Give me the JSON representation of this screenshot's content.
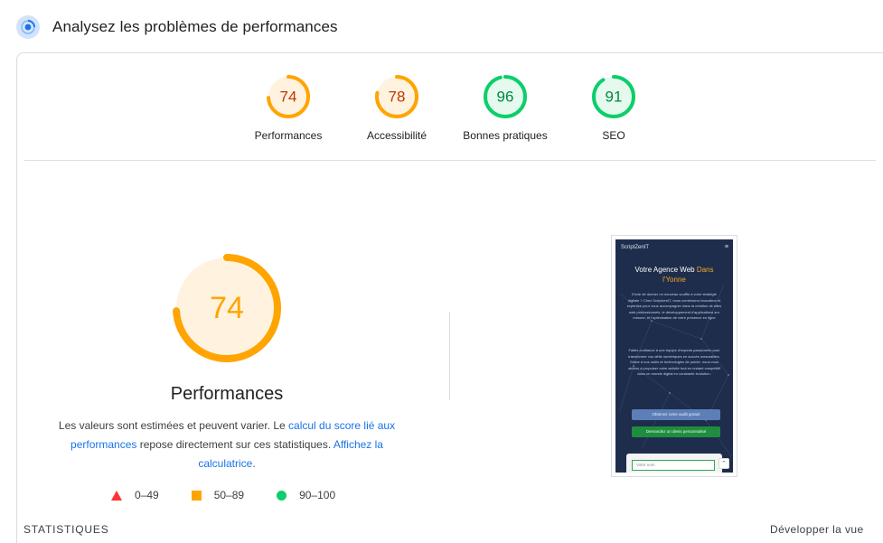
{
  "header": {
    "title": "Analysez les problèmes de performances",
    "icon": "lighthouse-icon"
  },
  "scores": [
    {
      "value": "74",
      "label": "Performances",
      "fraction": 0.74,
      "color": "#ffa400",
      "text_color": "#c33300",
      "bg": "#fff3e0"
    },
    {
      "value": "78",
      "label": "Accessibilité",
      "fraction": 0.78,
      "color": "#ffa400",
      "text_color": "#c33300",
      "bg": "#fff3e0"
    },
    {
      "value": "96",
      "label": "Bonnes pratiques",
      "fraction": 0.96,
      "color": "#0cce6b",
      "text_color": "#018642",
      "bg": "#e6f9ee"
    },
    {
      "value": "91",
      "label": "SEO",
      "fraction": 0.91,
      "color": "#0cce6b",
      "text_color": "#018642",
      "bg": "#e6f9ee"
    }
  ],
  "main": {
    "score": "74",
    "fraction": 0.74,
    "title": "Performances",
    "desc_1": "Les valeurs sont estimées et peuvent varier. Le ",
    "link_1": "calcul du score lié aux performances",
    "desc_2": " repose directement sur ces statistiques. ",
    "link_2": "Affichez la calculatrice",
    "desc_3": "."
  },
  "legend": [
    {
      "range": "0–49",
      "color": "#ff3333"
    },
    {
      "range": "50–89",
      "color": "#ffa400"
    },
    {
      "range": "90–100",
      "color": "#0cce6b"
    }
  ],
  "thumbnail": {
    "brand": "ScriptZenIT",
    "heading_1": "Votre Agence Web",
    "heading_accent": "Dans l'Yonne",
    "para_1": "Envie de donner un nouveau souffle à votre stratégie digitale ? Chez ScriptzenIT, nous combinons innovation et expertise pour vous accompagner dans la création de sites web professionnels, le développement d'applications sur mesure, et l'optimisation de votre présence en ligne",
    "para_2": "Faites confiance à une équipe d'experts passionnés pour transformer vos défis numériques en succès mesurables. Grâce à nos outils et technologies de pointe, nous vous aidons à propulser votre activité tout en restant compétitif dans un monde digital en constante évolution.",
    "btn_1": "Obtenez votre audit gratuit",
    "btn_2": "Demandez un devis personnalisé",
    "input_placeholder": "Votre nom"
  },
  "footer": {
    "statistics": "STATISTIQUES",
    "expand": "Développer la vue"
  }
}
